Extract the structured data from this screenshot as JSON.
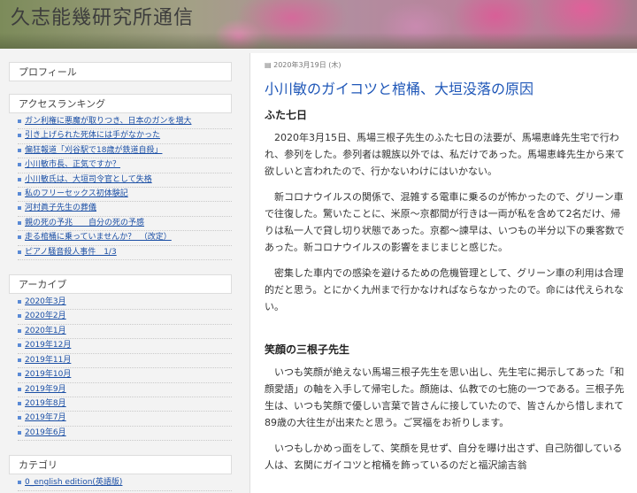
{
  "header": {
    "title": "久志能幾研究所通信"
  },
  "sidebar": {
    "profile": {
      "title": "プロフィール"
    },
    "ranking": {
      "title": "アクセスランキング",
      "items": [
        "ガン利権に悪魔が取りつき、日本のガンを増大",
        "引き上げられた死体には手がなかった",
        "偏狂報道「刈谷駅で18歳が鉄道自殺」",
        "小川敏市長、正気ですか？",
        "小川敏氏は、大垣司令官として失格",
        "私のフリーセックス初体験記",
        "河村眞子先生の葬儀",
        "親の死の予兆　　自分の死の予感",
        "走る棺桶に乗っていませんか？　（改定）",
        "ピアノ騒音殺人事件　1/3"
      ]
    },
    "archive": {
      "title": "アーカイブ",
      "items": [
        "2020年3月",
        "2020年2月",
        "2020年1月",
        "2019年12月",
        "2019年11月",
        "2019年10月",
        "2019年9月",
        "2019年8月",
        "2019年7月",
        "2019年6月"
      ]
    },
    "category": {
      "title": "カテゴリ",
      "items": [
        "0_english edition(英語版)"
      ]
    }
  },
  "post": {
    "date": "2020年3月19日 (木)",
    "title": "小川敏のガイコツと棺桶、大垣没落の原因",
    "section1_heading": "ふた七日",
    "paragraphs1": [
      "2020年3月15日、馬場三根子先生のふた七日の法要が、馬場恵峰先生宅で行われ、参列をした。参列者は親族以外では、私だけであった。馬場恵峰先生から来て欲しいと言われたので、行かないわけにはいかない。",
      "新コロナウイルスの関係で、混雑する電車に乗るのが怖かったので、グリーン車で往復した。驚いたことに、米原～京都間が行きは一両が私を含めて2名だけ、帰りは私一人で貸し切り状態であった。京都～諫早は、いつもの半分以下の乗客数であった。新コロナウイルスの影響をまじまじと感じた。",
      "密集した車内での感染を避けるための危機管理として、グリーン車の利用は合理的だと思う。とにかく九州まで行かなければならなかったので。命には代えられない。"
    ],
    "section2_heading": "笑顔の三根子先生",
    "paragraphs2": [
      "いつも笑顔が絶えない馬場三根子先生を思い出し、先生宅に掲示してあった「和顔愛語」の軸を入手して帰宅した。顔施は、仏教での七施の一つである。三根子先生は、いつも笑顔で優しい言葉で皆さんに接していたので、皆さんから惜しまれて89歳の大往生が出来たと思う。ご冥福をお祈りします。",
      "いつもしかめっ面をして、笑顔を見せず、自分を曝け出さず、自己防御している人は、玄関にガイコツと棺桶を飾っているのだと福沢諭吉翁"
    ]
  }
}
